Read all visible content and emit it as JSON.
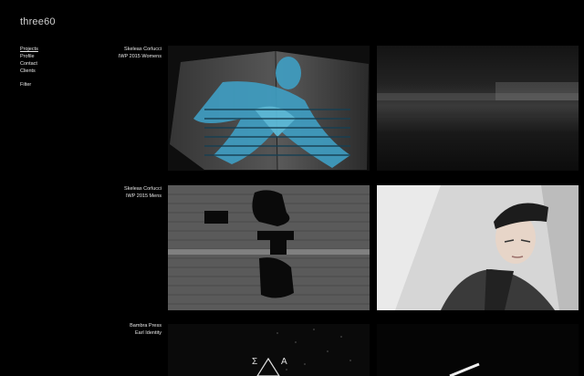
{
  "site": {
    "logo": "three60"
  },
  "nav": {
    "items": [
      {
        "label": "Projects"
      },
      {
        "label": "Profile"
      },
      {
        "label": "Contact"
      },
      {
        "label": "Clients"
      }
    ],
    "filter": "Filter"
  },
  "projects": [
    {
      "line1": "Skeleas Corlucci",
      "line2": "IWP 2015 Womens"
    },
    {
      "line1": "Skeleas Corlucci",
      "line2": "IWP 2015 Mens"
    },
    {
      "line1": "Bambra Press",
      "line2": "Earl Identity"
    }
  ],
  "thumb_glyphs": {
    "left": "Σ",
    "right": "Α"
  }
}
